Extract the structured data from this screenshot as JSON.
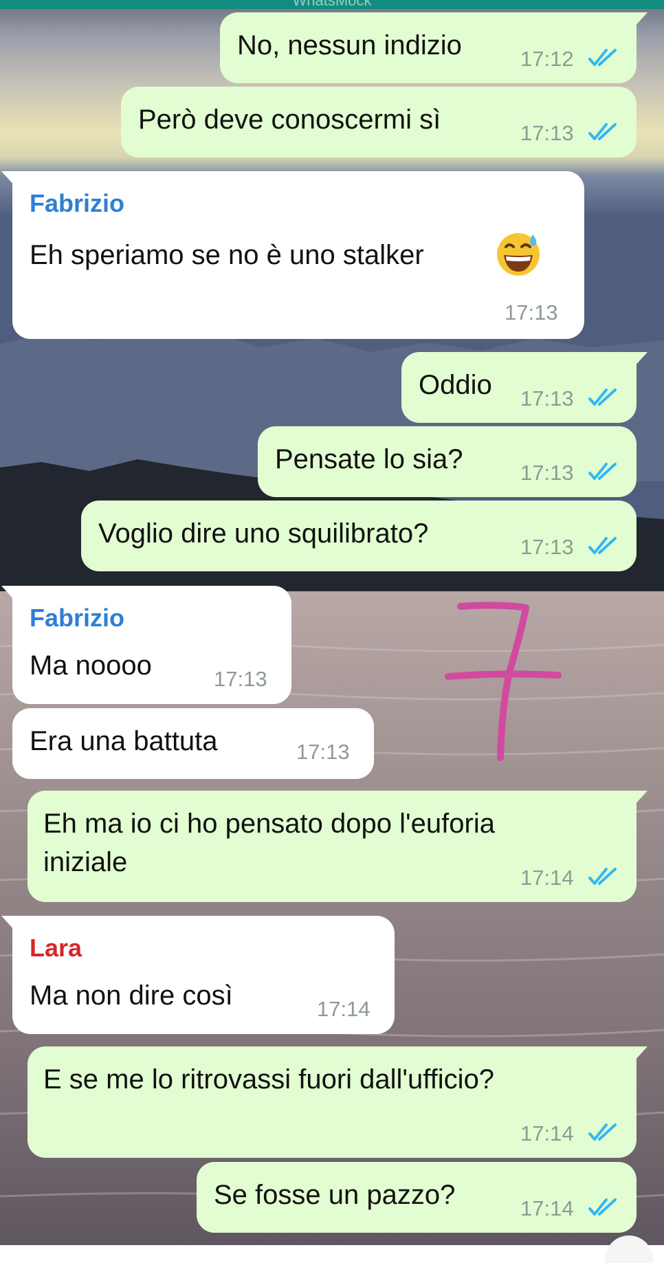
{
  "header": {
    "title": "WhatsMock"
  },
  "colors": {
    "outgoing_bubble": "#e2fdd1",
    "incoming_bubble": "#ffffff",
    "read_ticks": "#34b7f1",
    "timestamp": "#8e9a94",
    "sender_fabrizio": "#2f7fd3",
    "sender_lara": "#d92626",
    "annotation": "#d14aa0"
  },
  "messages": [
    {
      "direction": "out",
      "text": "No, nessun indizio",
      "time": "17:12",
      "status": "read"
    },
    {
      "direction": "out",
      "text": "Però deve conoscermi sì",
      "time": "17:13",
      "status": "read"
    },
    {
      "direction": "in",
      "sender": "Fabrizio",
      "text": "Eh speriamo se no è uno stalker",
      "emoji": "grinning-face-with-sweat",
      "time": "17:13"
    },
    {
      "direction": "out",
      "text": "Oddio",
      "time": "17:13",
      "status": "read"
    },
    {
      "direction": "out",
      "text": "Pensate lo sia?",
      "time": "17:13",
      "status": "read"
    },
    {
      "direction": "out",
      "text": "Voglio dire uno squilibrato?",
      "time": "17:13",
      "status": "read"
    },
    {
      "direction": "in",
      "sender": "Fabrizio",
      "text": "Ma noooo",
      "time": "17:13"
    },
    {
      "direction": "in",
      "text": "Era una battuta",
      "time": "17:13"
    },
    {
      "direction": "out",
      "text_lines": [
        "Eh ma io ci ho pensato dopo l'euforia",
        "iniziale"
      ],
      "time": "17:14",
      "status": "read"
    },
    {
      "direction": "in",
      "sender": "Lara",
      "text": "Ma non dire così",
      "time": "17:14"
    },
    {
      "direction": "out",
      "text": "E se me lo ritrovassi fuori dall'ufficio?",
      "time": "17:14",
      "status": "read"
    },
    {
      "direction": "out",
      "text": "Se fosse un pazzo?",
      "time": "17:14",
      "status": "read"
    }
  ],
  "annotation": {
    "text": "7"
  },
  "icons": {
    "read_receipt": "double-check-icon",
    "emoji": "grinning-face-with-sweat-icon"
  }
}
